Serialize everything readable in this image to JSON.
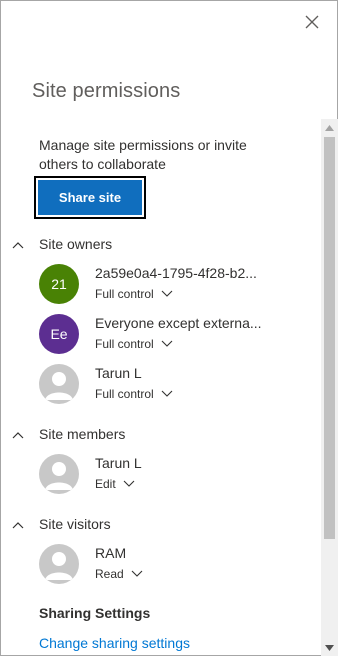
{
  "panel": {
    "title": "Site permissions",
    "close_icon": "close-icon"
  },
  "intro": {
    "text": "Manage site permissions or invite others to collaborate"
  },
  "share": {
    "label": "Share site",
    "color": "#106ebe"
  },
  "groups": [
    {
      "title": "Site owners",
      "members": [
        {
          "initials": "21",
          "name": "2a59e0a4-1795-4f28-b2...",
          "permission": "Full control",
          "avatar_color": "#498205"
        },
        {
          "initials": "Ee",
          "name": "Everyone except externa...",
          "permission": "Full control",
          "avatar_color": "#5c2e91"
        },
        {
          "initials": "",
          "name": "Tarun L",
          "permission": "Full control",
          "avatar_color": "#c8c8c8"
        }
      ]
    },
    {
      "title": "Site members",
      "members": [
        {
          "initials": "",
          "name": "Tarun L",
          "permission": "Edit",
          "avatar_color": "#c8c8c8"
        }
      ]
    },
    {
      "title": "Site visitors",
      "members": [
        {
          "initials": "",
          "name": "RAM",
          "permission": "Read",
          "avatar_color": "#c8c8c8"
        }
      ]
    }
  ],
  "sharing": {
    "title": "Sharing Settings",
    "link": "Change sharing settings",
    "link_color": "#0078d4"
  }
}
